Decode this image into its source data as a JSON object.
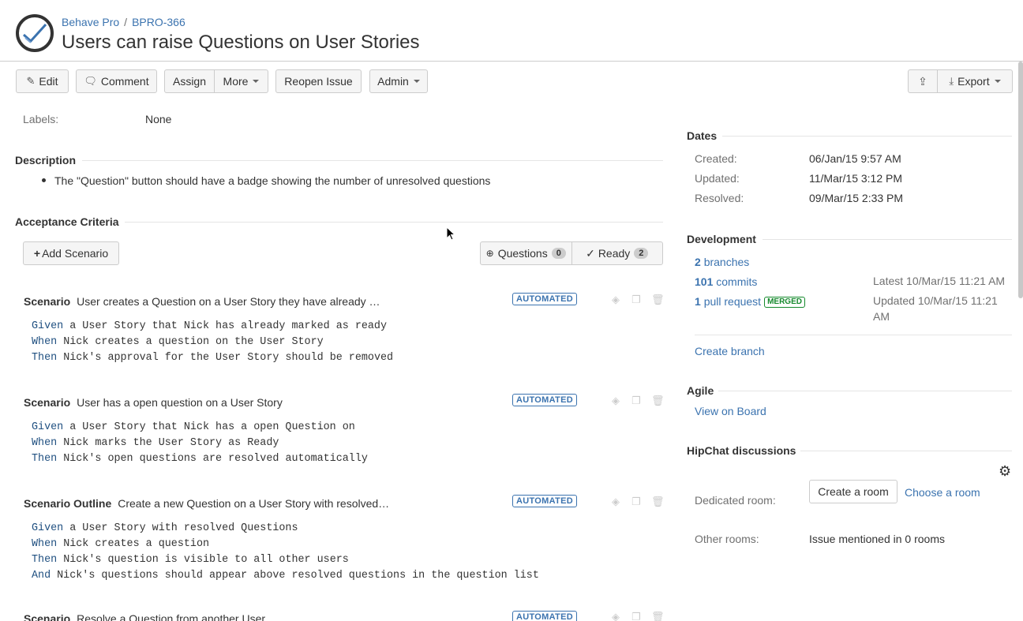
{
  "breadcrumb": {
    "project": "Behave Pro",
    "issue_key": "BPRO-366"
  },
  "title": "Users can raise Questions on User Stories",
  "toolbar": {
    "edit": "Edit",
    "comment": "Comment",
    "assign": "Assign",
    "more": "More",
    "reopen": "Reopen Issue",
    "admin": "Admin",
    "export": "Export"
  },
  "labels": {
    "label": "Labels:",
    "value": "None"
  },
  "description": {
    "heading": "Description",
    "items": [
      "The \"Question\" button should have a badge showing the number of unresolved questions"
    ]
  },
  "acceptance": {
    "heading": "Acceptance Criteria",
    "add_scenario": "Add Scenario",
    "questions_label": "Questions",
    "questions_count": "0",
    "ready_label": "Ready",
    "ready_count": "2",
    "badge": "AUTOMATED",
    "scenarios": [
      {
        "keyword": "Scenario",
        "title": "User creates a Question on a User Story they have already …",
        "steps": [
          {
            "kw": "Given",
            "text": " a User Story that Nick has already marked as ready"
          },
          {
            "kw": "When",
            "text": " Nick creates a question on the User Story"
          },
          {
            "kw": "Then",
            "text": " Nick's approval for the User Story should be removed"
          }
        ]
      },
      {
        "keyword": "Scenario",
        "title": "User has a open question on a User Story",
        "steps": [
          {
            "kw": "Given",
            "text": " a User Story that Nick has a open Question on"
          },
          {
            "kw": "When",
            "text": " Nick marks the User Story as Ready"
          },
          {
            "kw": "Then",
            "text": " Nick's open questions are resolved automatically"
          }
        ]
      },
      {
        "keyword": "Scenario Outline",
        "title": "Create a new Question on a User Story with resolved…",
        "steps": [
          {
            "kw": "Given",
            "text": " a User Story with resolved Questions"
          },
          {
            "kw": "When",
            "text": " Nick creates a question"
          },
          {
            "kw": "Then",
            "text": " Nick's question is visible to all other users"
          },
          {
            "kw": "And",
            "text": " Nick's questions should appear above resolved questions in the question list"
          }
        ]
      },
      {
        "keyword": "Scenario",
        "title": "Resolve a Question from another User",
        "steps": []
      }
    ]
  },
  "dates": {
    "heading": "Dates",
    "created_label": "Created:",
    "created": "06/Jan/15 9:57 AM",
    "updated_label": "Updated:",
    "updated": "11/Mar/15 3:12 PM",
    "resolved_label": "Resolved:",
    "resolved": "09/Mar/15 2:33 PM"
  },
  "development": {
    "heading": "Development",
    "branches_count": "2",
    "branches_label": "branches",
    "commits_count": "101",
    "commits_label": "commits",
    "commits_meta": "Latest 10/Mar/15 11:21 AM",
    "pr_count": "1",
    "pr_label": "pull request",
    "pr_status": "MERGED",
    "pr_meta": "Updated 10/Mar/15 11:21 AM",
    "create_branch": "Create branch"
  },
  "agile": {
    "heading": "Agile",
    "view_on_board": "View on Board"
  },
  "hipchat": {
    "heading": "HipChat discussions",
    "dedicated_label": "Dedicated room:",
    "create_room": "Create a room",
    "choose_room": "Choose a room",
    "other_label": "Other rooms:",
    "other_value": "Issue mentioned in 0 rooms"
  },
  "colors": {
    "link": "#3b73af",
    "keyword": "#205081",
    "merged": "#14892c"
  }
}
